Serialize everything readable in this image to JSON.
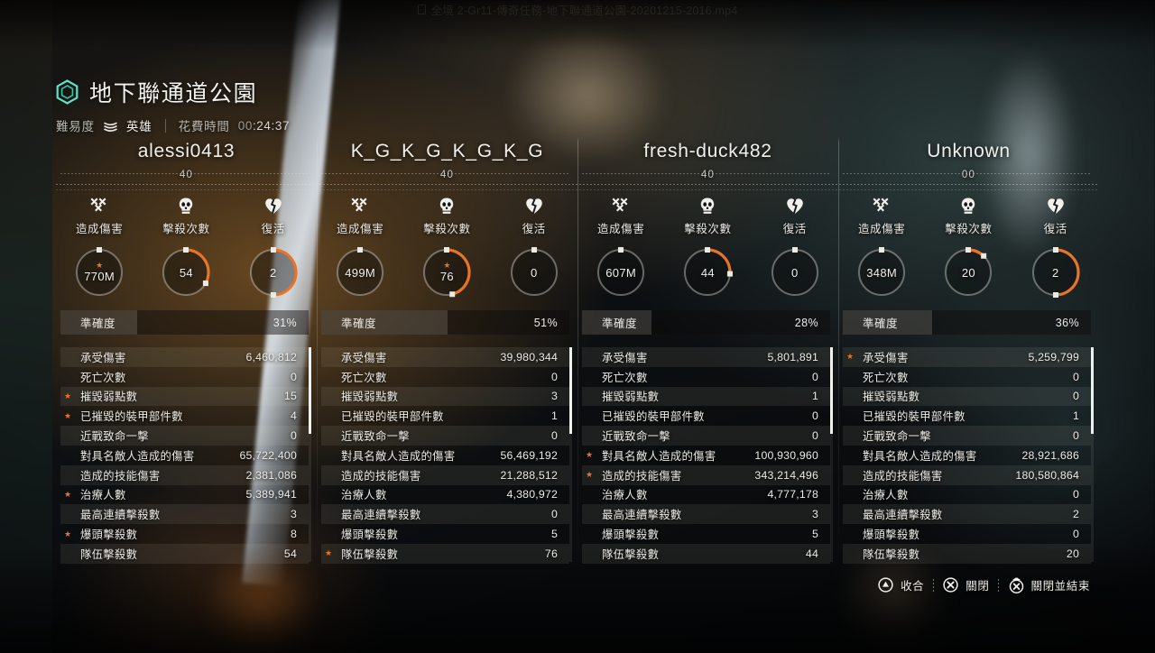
{
  "video_overlay": {
    "filename": "全境 2-Gr11-傳奇任務-地下聯通道公園-20201215-2016.mp4",
    "doc_icon": "document-icon"
  },
  "header": {
    "hex_icon": "hexagon-icon",
    "title": "地下聯通道公園",
    "difficulty_label": "難易度",
    "difficulty_icon": "chevrons-icon",
    "difficulty_value": "英雄",
    "time_label": "花費時間",
    "time_value": "00:24:37",
    "time_prefix": "00",
    "time_rest": ":24:37"
  },
  "metric_headers": [
    {
      "icon": "crossed-x-icon",
      "label": "造成傷害"
    },
    {
      "icon": "skull-icon",
      "label": "擊殺次數"
    },
    {
      "icon": "broken-heart-icon",
      "label": "復活"
    }
  ],
  "accuracy_label": "準確度",
  "stat_labels": [
    "承受傷害",
    "死亡次數",
    "摧毀弱點數",
    "已摧毀的裝甲部件數",
    "近戰致命一擊",
    "對具名敵人造成的傷害",
    "造成的技能傷害",
    "治療人數",
    "最高連續擊殺數",
    "爆頭擊殺數",
    "隊伍擊殺數"
  ],
  "players": [
    {
      "name": "alessi0413",
      "level": "40",
      "gauges": [
        {
          "value": "770M",
          "pct": 0,
          "star": true
        },
        {
          "value": "54",
          "pct": 33,
          "star": false
        },
        {
          "value": "2",
          "pct": 50,
          "star": false
        }
      ],
      "accuracy": "31%",
      "accuracy_pct": 31,
      "stats": [
        "6,460,812",
        "0",
        "15",
        "4",
        "0",
        "65,722,400",
        "2,381,086",
        "5,389,941",
        "3",
        "8",
        "54"
      ],
      "stars": [
        false,
        false,
        true,
        true,
        false,
        false,
        false,
        true,
        false,
        true,
        false
      ],
      "scroll_top": 0,
      "scroll_height": 96
    },
    {
      "name": "K_G_K_G_K_G_K_G",
      "level": "40",
      "gauges": [
        {
          "value": "499M",
          "pct": 0,
          "star": false
        },
        {
          "value": "76",
          "pct": 46,
          "star": true
        },
        {
          "value": "0",
          "pct": 0,
          "star": false
        }
      ],
      "accuracy": "51%",
      "accuracy_pct": 51,
      "stats": [
        "39,980,344",
        "0",
        "3",
        "1",
        "0",
        "56,469,192",
        "21,288,512",
        "4,380,972",
        "0",
        "5",
        "76"
      ],
      "stars": [
        false,
        false,
        false,
        false,
        false,
        false,
        false,
        false,
        false,
        false,
        true
      ],
      "scroll_top": 0,
      "scroll_height": 96
    },
    {
      "name": "fresh-duck482",
      "level": "40",
      "gauges": [
        {
          "value": "607M",
          "pct": 0,
          "star": false
        },
        {
          "value": "44",
          "pct": 26,
          "star": false
        },
        {
          "value": "0",
          "pct": 0,
          "star": false
        }
      ],
      "accuracy": "28%",
      "accuracy_pct": 28,
      "stats": [
        "5,801,891",
        "0",
        "1",
        "0",
        "0",
        "100,930,960",
        "343,214,496",
        "4,777,178",
        "3",
        "5",
        "44"
      ],
      "stars": [
        false,
        false,
        false,
        false,
        false,
        true,
        true,
        false,
        false,
        false,
        false
      ],
      "scroll_top": 0,
      "scroll_height": 96
    },
    {
      "name": "Unknown",
      "level": "00",
      "gauges": [
        {
          "value": "348M",
          "pct": 0,
          "star": false
        },
        {
          "value": "20",
          "pct": 12,
          "star": false
        },
        {
          "value": "2",
          "pct": 50,
          "star": false
        }
      ],
      "accuracy": "36%",
      "accuracy_pct": 36,
      "stats": [
        "5,259,799",
        "0",
        "0",
        "1",
        "0",
        "28,921,686",
        "180,580,864",
        "0",
        "2",
        "0",
        "20"
      ],
      "stars": [
        true,
        false,
        false,
        false,
        false,
        false,
        false,
        false,
        false,
        false,
        false
      ],
      "scroll_top": 0,
      "scroll_height": 96
    }
  ],
  "footer_buttons": [
    {
      "icon": "triangle-button-icon",
      "label": "收合"
    },
    {
      "icon": "cross-button-icon",
      "label": "關閉"
    },
    {
      "icon": "hold-cross-button-icon",
      "label": "關閉並結束"
    }
  ],
  "colors": {
    "accent_orange": "#e8742a",
    "hex_teal": "#5fe3c8",
    "text": "#eceae5"
  }
}
